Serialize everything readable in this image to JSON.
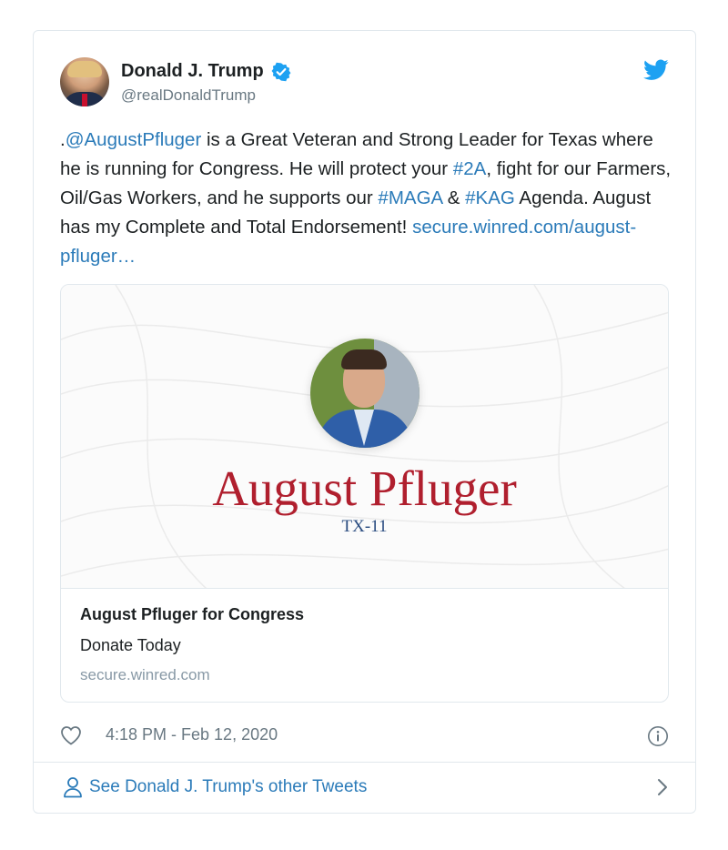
{
  "user": {
    "display_name": "Donald J. Trump",
    "handle": "@realDonaldTrump",
    "verified": true
  },
  "tweet": {
    "segments": [
      {
        "text": ".",
        "link": false
      },
      {
        "text": "@AugustPfluger",
        "link": true
      },
      {
        "text": " is a Great Veteran and Strong Leader for Texas where he is running for Congress. He will protect your ",
        "link": false
      },
      {
        "text": "#2A",
        "link": true
      },
      {
        "text": ", fight for our Farmers, Oil/Gas Workers, and he supports our ",
        "link": false
      },
      {
        "text": "#MAGA",
        "link": true
      },
      {
        "text": " & ",
        "link": false
      },
      {
        "text": "#KAG",
        "link": true
      },
      {
        "text": " Agenda. August has my Complete and Total Endorsement! ",
        "link": false
      },
      {
        "text": "secure.winred.com/august-pfluger…",
        "link": true
      }
    ]
  },
  "card": {
    "image_headline": "August Pfluger",
    "image_subheadline": "TX-11",
    "title": "August Pfluger for Congress",
    "description": "Donate Today",
    "domain": "secure.winred.com"
  },
  "meta": {
    "timestamp": "4:18 PM - Feb 12, 2020"
  },
  "footer": {
    "more_tweets_label": "See Donald J. Trump's other Tweets"
  },
  "colors": {
    "link": "#2b7bb9",
    "verified": "#1da1f2",
    "twitter_bird": "#1da1f2",
    "headline_red": "#b01f2e",
    "subheadline_blue": "#2a4c80",
    "muted": "#697882"
  },
  "icons": [
    "verified-badge-icon",
    "twitter-bird-icon",
    "heart-icon",
    "info-icon",
    "person-icon",
    "chevron-right-icon"
  ]
}
